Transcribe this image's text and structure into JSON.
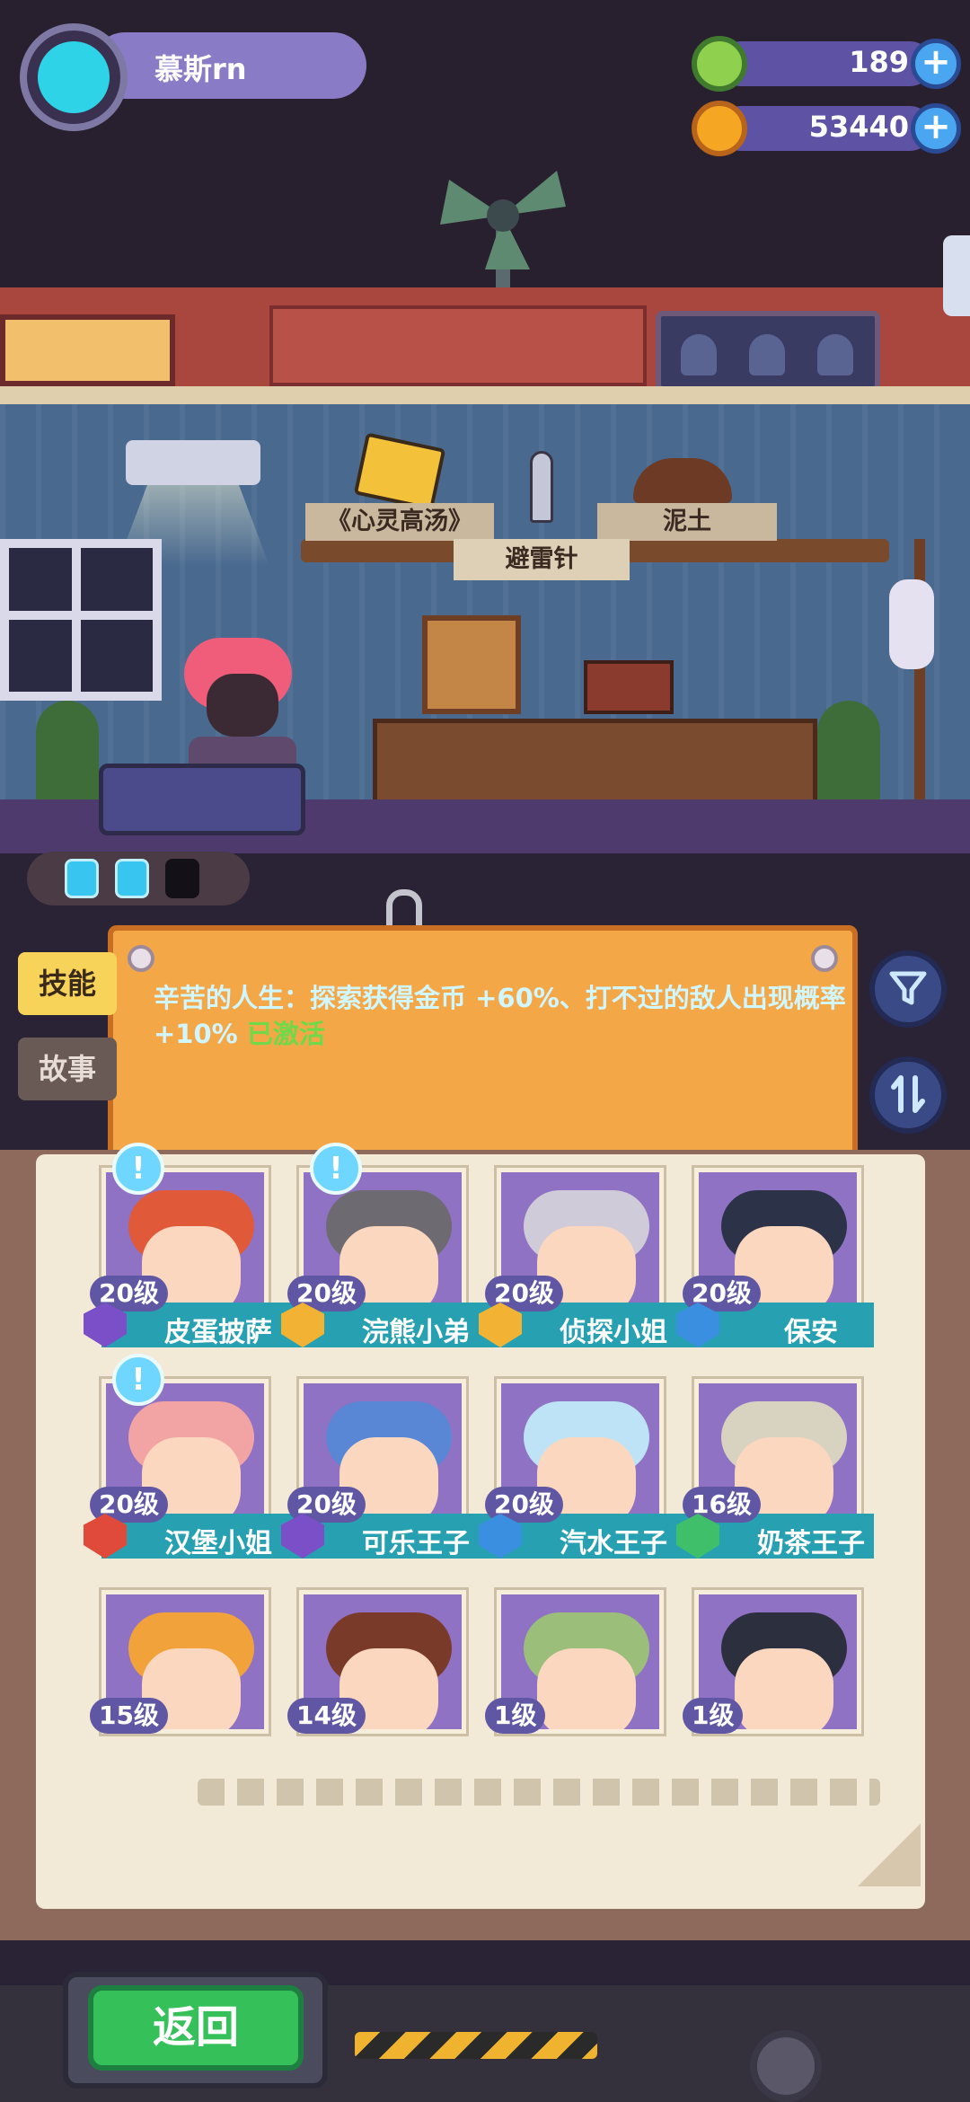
{
  "player": {
    "name": "慕斯rn"
  },
  "currencies": [
    {
      "icon": "green-donut-icon",
      "value": "189",
      "color": "#8fd14f"
    },
    {
      "icon": "orange-planet-icon",
      "value": "53440",
      "color": "#f5a623"
    }
  ],
  "shelf": {
    "book_label": "《心灵高汤》",
    "rod_label": "避雷针",
    "dirt_label": "泥土"
  },
  "energy": {
    "filled": 2,
    "total": 3
  },
  "skill": {
    "text": "辛苦的人生：探索获得金币 +60%、打不过的敌人出现概率 +10% ",
    "status": "已激活"
  },
  "side_tabs": {
    "skill": "技能",
    "story": "故事"
  },
  "characters": [
    {
      "name": "皮蛋披萨",
      "level": "20级",
      "badge": "purple-shield",
      "badge_color": "#7a4fc8",
      "alert": true,
      "hair": "#e05a3a"
    },
    {
      "name": "浣熊小弟",
      "level": "20级",
      "badge": "gold-hexagon",
      "badge_color": "#f2b233",
      "alert": true,
      "hair": "#6e6a72"
    },
    {
      "name": "侦探小姐",
      "level": "20级",
      "badge": "gold-hexagon",
      "badge_color": "#f2b233",
      "alert": false,
      "hair": "#d0cbd8"
    },
    {
      "name": "保安",
      "level": "20级",
      "badge": "blue-shield",
      "badge_color": "#3a8fe0",
      "alert": false,
      "hair": "#2c3348"
    },
    {
      "name": "汉堡小姐",
      "level": "20级",
      "badge": "red-hexagon",
      "badge_color": "#e04a3a",
      "alert": true,
      "hair": "#f2a3a3"
    },
    {
      "name": "可乐王子",
      "level": "20级",
      "badge": "purple-shield",
      "badge_color": "#7a4fc8",
      "alert": false,
      "hair": "#5a86d6"
    },
    {
      "name": "汽水王子",
      "level": "20级",
      "badge": "blue-shield",
      "badge_color": "#3a8fe0",
      "alert": false,
      "hair": "#bfe3f6"
    },
    {
      "name": "奶茶王子",
      "level": "16级",
      "badge": "green-shield",
      "badge_color": "#3fbf6a",
      "alert": false,
      "hair": "#d8d2c0"
    },
    {
      "name": "",
      "level": "15级",
      "badge": "",
      "badge_color": "",
      "alert": false,
      "hair": "#f2a23a"
    },
    {
      "name": "",
      "level": "14级",
      "badge": "",
      "badge_color": "",
      "alert": false,
      "hair": "#7a3a2a"
    },
    {
      "name": "",
      "level": "1级",
      "badge": "",
      "badge_color": "",
      "alert": false,
      "hair": "#9bbf7a"
    },
    {
      "name": "",
      "level": "1级",
      "badge": "",
      "badge_color": "",
      "alert": false,
      "hair": "#2c2f3e"
    }
  ],
  "footer": {
    "back_label": "返回"
  },
  "buttons": {
    "filter_icon": "filter-icon",
    "sort_icon": "sort-icon",
    "alert_mark": "!"
  }
}
